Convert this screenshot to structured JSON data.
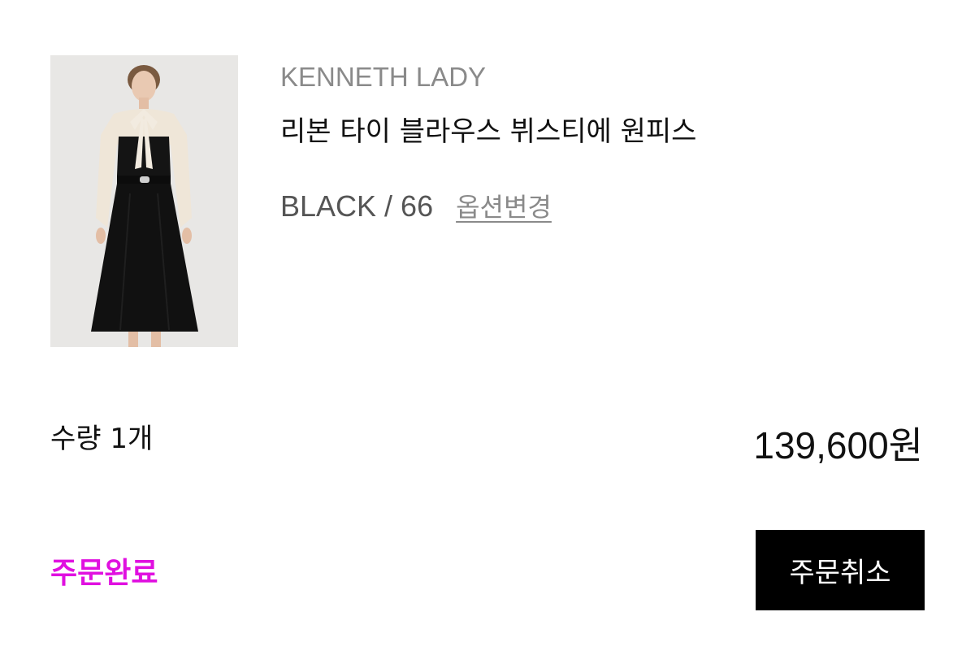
{
  "order_item": {
    "image_alt": "리본 타이 블라우스 뷔스티에 원피스",
    "brand": "KENNETH LADY",
    "product_name": "리본 타이 블라우스 뷔스티에 원피스",
    "option": "BLACK / 66",
    "option_change_label": "옵션변경",
    "quantity_label": "수량 1개",
    "price": "139,600원",
    "status": "주문완료",
    "cancel_label": "주문취소"
  },
  "colors": {
    "status": "#e010e0",
    "button_bg": "#000000",
    "brand_text": "#8a8a8a"
  }
}
